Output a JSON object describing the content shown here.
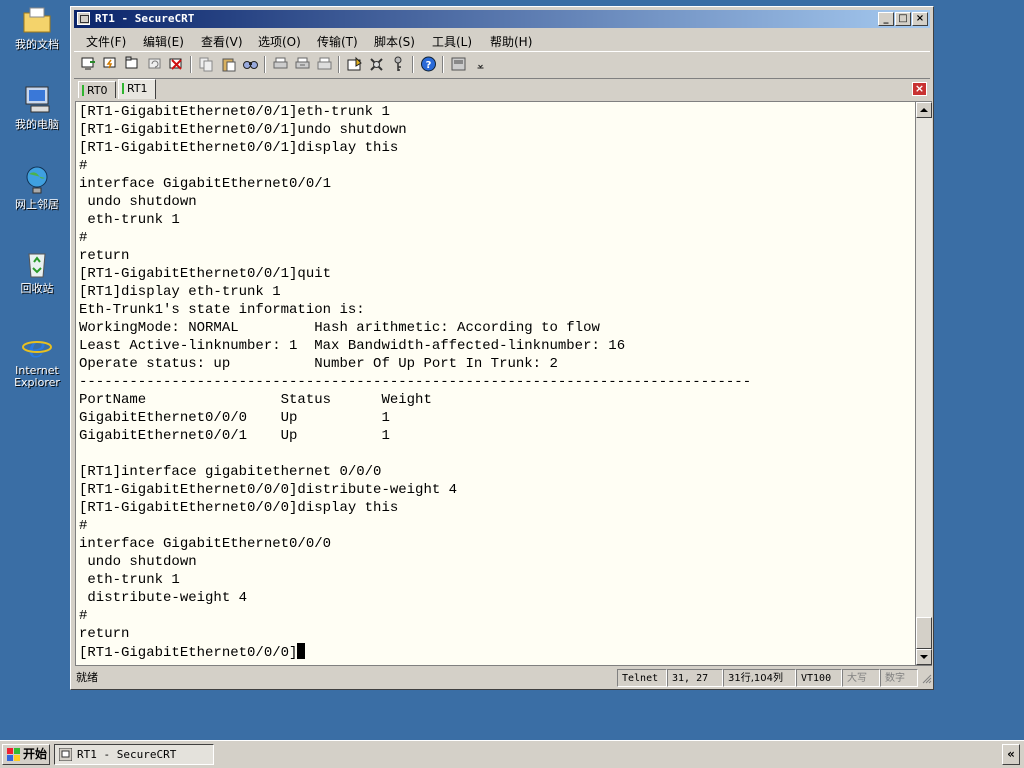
{
  "desktop": {
    "icons": [
      {
        "label": "我的文档"
      },
      {
        "label": "我的电脑"
      },
      {
        "label": "网上邻居"
      },
      {
        "label": "回收站"
      },
      {
        "label": "Internet Explorer"
      }
    ]
  },
  "window": {
    "title": "RT1 - SecureCRT",
    "controls": {
      "minimize": "_",
      "maximize": "□",
      "close": "×"
    }
  },
  "menu": [
    {
      "label": "文件(F)"
    },
    {
      "label": "编辑(E)"
    },
    {
      "label": "查看(V)"
    },
    {
      "label": "选项(O)"
    },
    {
      "label": "传输(T)"
    },
    {
      "label": "脚本(S)"
    },
    {
      "label": "工具(L)"
    },
    {
      "label": "帮助(H)"
    }
  ],
  "toolbar": {
    "icons": [
      "connect-icon",
      "quick-connect-icon",
      "connect-tab-icon",
      "reconnect-icon",
      "disconnect-icon",
      "copy-icon",
      "paste-icon",
      "find-icon",
      "print-icon",
      "print-selection-icon",
      "print-setup-icon",
      "session-options-icon",
      "keymap-icon",
      "key-icon",
      "help-icon",
      "sftp-icon"
    ]
  },
  "tabs": [
    {
      "label": "RT0",
      "active": false
    },
    {
      "label": "RT1",
      "active": true
    }
  ],
  "terminal": {
    "lines": [
      "[RT1-GigabitEthernet0/0/1]eth-trunk 1",
      "[RT1-GigabitEthernet0/0/1]undo shutdown",
      "[RT1-GigabitEthernet0/0/1]display this",
      "#",
      "interface GigabitEthernet0/0/1",
      " undo shutdown",
      " eth-trunk 1",
      "#",
      "return",
      "[RT1-GigabitEthernet0/0/1]quit",
      "[RT1]display eth-trunk 1",
      "Eth-Trunk1's state information is:",
      "WorkingMode: NORMAL         Hash arithmetic: According to flow",
      "Least Active-linknumber: 1  Max Bandwidth-affected-linknumber: 16",
      "Operate status: up          Number Of Up Port In Trunk: 2",
      "--------------------------------------------------------------------------------",
      "PortName                Status      Weight",
      "GigabitEthernet0/0/0    Up          1",
      "GigabitEthernet0/0/1    Up          1",
      "",
      "[RT1]interface gigabitethernet 0/0/0",
      "[RT1-GigabitEthernet0/0/0]distribute-weight 4",
      "[RT1-GigabitEthernet0/0/0]display this",
      "#",
      "interface GigabitEthernet0/0/0",
      " undo shutdown",
      " eth-trunk 1",
      " distribute-weight 4",
      "#",
      "return"
    ],
    "prompt": "[RT1-GigabitEthernet0/0/0]"
  },
  "status": {
    "ready": "就绪",
    "protocol": "Telnet",
    "position": "31,  27",
    "rows_cols": "31行,104列",
    "emulation": "VT100",
    "caps": "大写",
    "num": "数字"
  },
  "taskbar": {
    "start": "开始",
    "task": "RT1 - SecureCRT",
    "tray": "«"
  },
  "colors": {
    "desktop": "#3a6ea5",
    "title_start": "#0a246a",
    "title_end": "#a6caf0",
    "terminal_bg": "#fffef4"
  }
}
